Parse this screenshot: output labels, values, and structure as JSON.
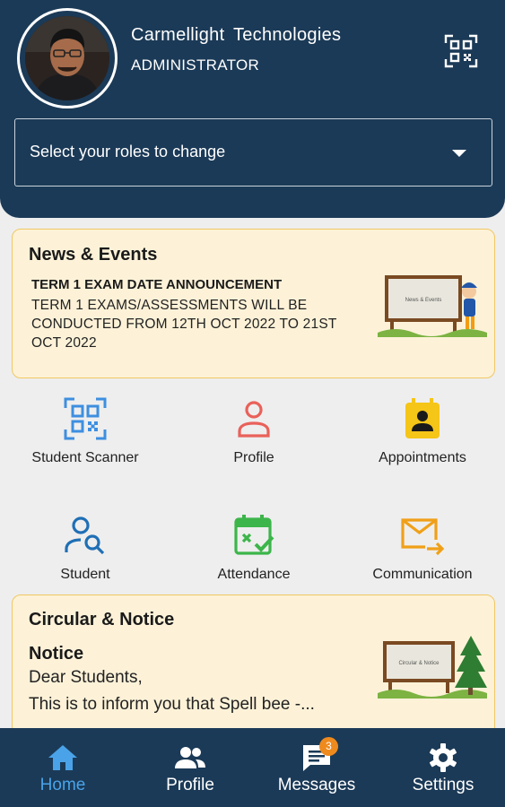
{
  "header": {
    "org_name": "Carmellight Technologies",
    "role": "ADMINISTRATOR",
    "role_select_placeholder": "Select your roles to change"
  },
  "news": {
    "title": "News & Events",
    "headline": "TERM 1 EXAM DATE ANNOUNCEMENT",
    "body": "TERM 1 EXAMS/ASSESSMENTS WILL BE CONDUCTED FROM 12TH OCT 2022 TO 21ST OCT 2022",
    "image_caption": "News & Events"
  },
  "tiles": [
    {
      "label": "Student Scanner",
      "icon": "qr-scan-icon",
      "color": "#3d8fe0"
    },
    {
      "label": "Profile",
      "icon": "person-icon",
      "color": "#e9615a"
    },
    {
      "label": "Appointments",
      "icon": "contact-book-icon",
      "color": "#f5c518"
    },
    {
      "label": "Student",
      "icon": "person-search-icon",
      "color": "#1f6fb5"
    },
    {
      "label": "Attendance",
      "icon": "calendar-check-icon",
      "color": "#3cb54a"
    },
    {
      "label": "Communication",
      "icon": "mail-forward-icon",
      "color": "#f0a018"
    }
  ],
  "circular": {
    "title": "Circular & Notice",
    "notice_heading": "Notice",
    "line1": "Dear Students,",
    "line2": "This is to inform you that Spell bee -...",
    "image_caption": "Circular & Notice"
  },
  "bottom_nav": {
    "items": [
      {
        "label": "Home",
        "icon": "home-icon",
        "active": true
      },
      {
        "label": "Profile",
        "icon": "people-icon",
        "active": false
      },
      {
        "label": "Messages",
        "icon": "chat-icon",
        "active": false
      },
      {
        "label": "Settings",
        "icon": "gear-icon",
        "active": false
      }
    ],
    "messages_badge": "3",
    "active_color": "#4aa3e8"
  },
  "colors": {
    "primary": "#1b3a57",
    "card_bg": "#fdf2d8",
    "card_border": "#f0c864"
  }
}
